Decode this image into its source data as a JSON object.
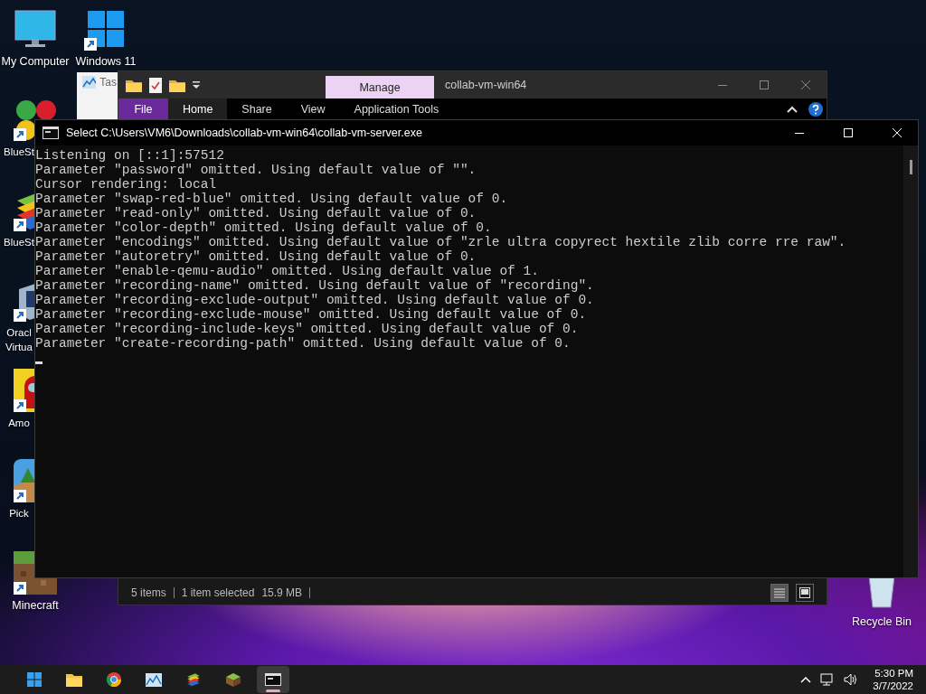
{
  "desktop_icons": [
    {
      "label": "My Computer",
      "kind": "monitor",
      "shortcut": false,
      "clipped": false
    },
    {
      "label": "Windows 11",
      "kind": "windows-logo",
      "shortcut": true,
      "clipped": false
    },
    {
      "label": "BlueSt",
      "kind": "bluestacks-x",
      "shortcut": true,
      "clipped": true
    },
    {
      "label": "BlueSt",
      "kind": "bluestacks",
      "shortcut": true,
      "clipped": true
    },
    {
      "label": "Oracl Virtua",
      "kind": "virtualbox",
      "shortcut": true,
      "clipped": true
    },
    {
      "label": "Amo",
      "kind": "among-us",
      "shortcut": true,
      "clipped": true
    },
    {
      "label": "Pick",
      "kind": "game",
      "shortcut": true,
      "clipped": true
    },
    {
      "label": "Minecraft",
      "kind": "minecraft",
      "shortcut": true,
      "clipped": false
    },
    {
      "label": "Recycle Bin",
      "kind": "recycle-bin",
      "shortcut": false,
      "clipped": false
    }
  ],
  "background_window": {
    "title": "Tas"
  },
  "explorer": {
    "title": "collab-vm-win64",
    "context_tab": "Manage",
    "ribbon_tabs": [
      {
        "label": "File",
        "kind": "file-menu",
        "selected": false
      },
      {
        "label": "Home",
        "kind": "tab",
        "selected": true
      },
      {
        "label": "Share",
        "kind": "tab",
        "selected": false
      },
      {
        "label": "View",
        "kind": "tab",
        "selected": false
      },
      {
        "label": "Application Tools",
        "kind": "tab",
        "selected": false
      }
    ],
    "status_bar": [
      "5 items",
      "1 item selected",
      "15.9 MB"
    ]
  },
  "console": {
    "title": "Select C:\\Users\\VM6\\Downloads\\collab-vm-win64\\collab-vm-server.exe",
    "lines": [
      "Listening on [::1]:57512",
      "Parameter \"password\" omitted. Using default value of \"\".",
      "Cursor rendering: local",
      "Parameter \"swap-red-blue\" omitted. Using default value of 0.",
      "Parameter \"read-only\" omitted. Using default value of 0.",
      "Parameter \"color-depth\" omitted. Using default value of 0.",
      "Parameter \"encodings\" omitted. Using default value of \"zrle ultra copyrect hextile zlib corre rre raw\".",
      "Parameter \"autoretry\" omitted. Using default value of 0.",
      "Parameter \"enable-qemu-audio\" omitted. Using default value of 1.",
      "Parameter \"recording-name\" omitted. Using default value of \"recording\".",
      "Parameter \"recording-exclude-output\" omitted. Using default value of 0.",
      "Parameter \"recording-exclude-mouse\" omitted. Using default value of 0.",
      "Parameter \"recording-include-keys\" omitted. Using default value of 0.",
      "Parameter \"create-recording-path\" omitted. Using default value of 0."
    ]
  },
  "taskbar": {
    "apps": [
      {
        "kind": "start",
        "selected": false
      },
      {
        "kind": "folder",
        "selected": false
      },
      {
        "kind": "browser",
        "selected": false
      },
      {
        "kind": "chart",
        "selected": false
      },
      {
        "kind": "bluestacks",
        "selected": false
      },
      {
        "kind": "minecraft",
        "selected": false
      },
      {
        "kind": "console",
        "selected": true
      }
    ],
    "time": "5:30 PM",
    "date": "3/7/2022"
  }
}
